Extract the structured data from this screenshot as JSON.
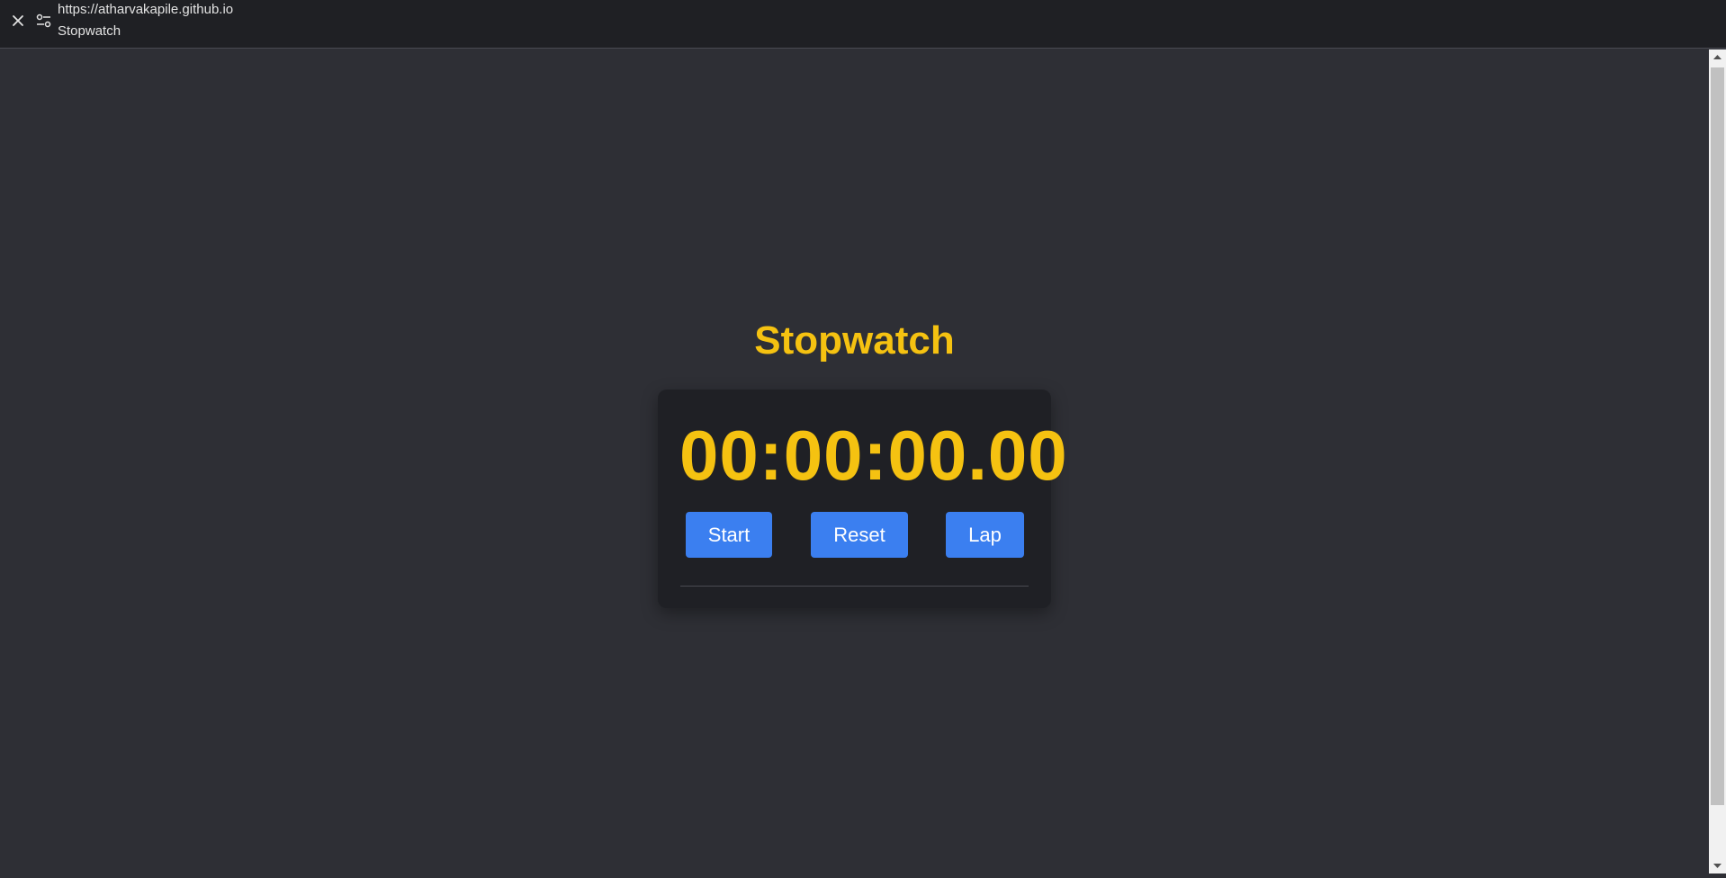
{
  "browser": {
    "url": "https://atharvakapile.github.io",
    "tab_title": "Stopwatch"
  },
  "icons": {
    "close": "close-icon",
    "tune": "tune-icon"
  },
  "page": {
    "title": "Stopwatch",
    "time": "00:00:00.00",
    "buttons": {
      "start": "Start",
      "reset": "Reset",
      "lap": "Lap"
    },
    "laps": []
  },
  "colors": {
    "accent": "#f5c211",
    "button": "#3b7ff0",
    "background": "#2e2f35",
    "card": "#1f2025"
  }
}
